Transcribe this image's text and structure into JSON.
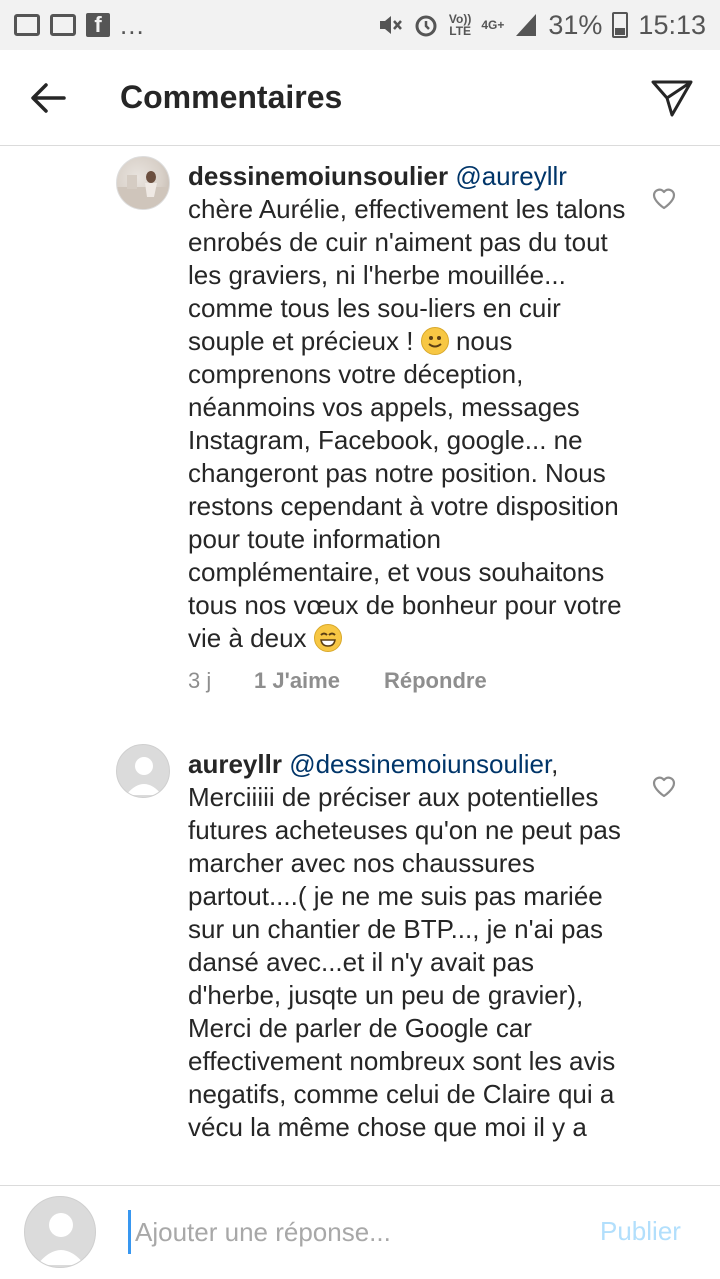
{
  "status_bar": {
    "icons": [
      "image-icon",
      "settings-icon",
      "facebook-icon"
    ],
    "facebook_glyph": "f",
    "dots": "...",
    "volte_top": "Vo))",
    "volte_bottom": "LTE",
    "network": "4G+",
    "battery": "31%",
    "time": "15:13"
  },
  "header": {
    "title": "Commentaires"
  },
  "comments": [
    {
      "username": "dessinemoiunsoulier",
      "mention": "@aureyllr",
      "text_a": "chère Aurélie, effectivement les talons enrobés de cuir n'aiment pas du tout les graviers, ni l'herbe mouillée... comme tous les sou-liers en cuir souple et précieux !",
      "text_b": "nous comprenons votre déception, néanmoins vos appels, messages Instagram, Facebook, google... ne changeront pas notre position. Nous restons cependant à votre disposition pour toute information complémentaire, et vous souhaitons tous nos vœux de bonheur pour votre vie à deux",
      "time": "3 j",
      "likes": "1 J'aime",
      "reply": "Répondre"
    },
    {
      "username": "aureyllr",
      "mention": "@dessinemoiunsoulier",
      "mention_suffix": ",",
      "text": "Merciiiii de préciser aux potentielles futures acheteuses qu'on ne peut pas marcher avec nos chaussures partout....( je ne me suis pas mariée sur un chantier de BTP..., je n'ai pas dansé avec...et il n'y avait pas d'herbe, jusqte un peu de gravier), Merci de parler de Google car effectivement nombreux sont les avis negatifs, comme celui de Claire qui a vécu la même chose que moi il y a"
    }
  ],
  "reply_bar": {
    "placeholder": "Ajouter une réponse...",
    "publish_label": "Publier"
  }
}
